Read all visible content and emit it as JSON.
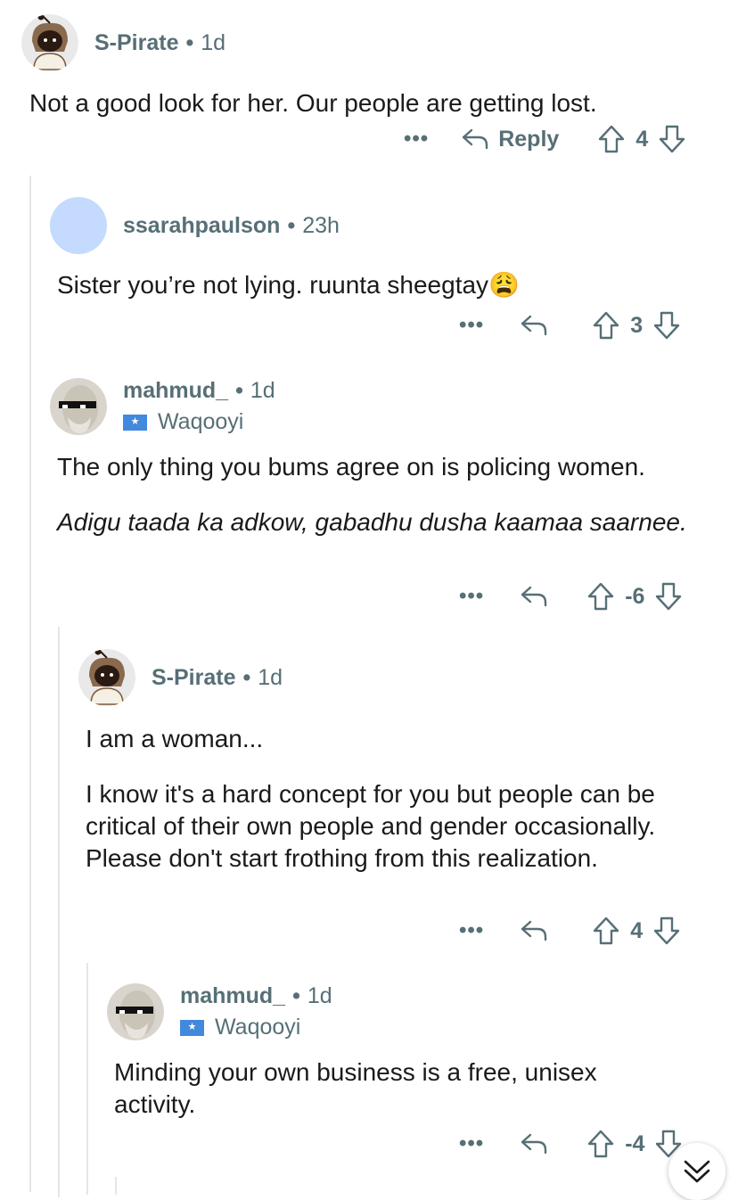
{
  "comments": [
    {
      "username": "S-Pirate",
      "time": "1d",
      "body": [
        "Not a good look for her. Our people are getting lost."
      ],
      "reply_label": "Reply",
      "votes": "4",
      "avatar": "pirate-snoo-avatar"
    },
    {
      "username": "ssarahpaulson",
      "time": "23h",
      "body": [
        "Sister you’re not lying. ruunta sheegtay"
      ],
      "emoji": "😩",
      "votes": "3",
      "avatar": "default-blue-avatar",
      "avatar_color": "#c4dafe"
    },
    {
      "username": "mahmud_",
      "time": "1d",
      "flair": "Waqooyi",
      "body": [
        "The only thing you bums agree on is policing women.",
        "Adigu taada ka adkow, gabadhu dusha kaamaa saarnee."
      ],
      "votes": "-6",
      "avatar": "statue-sunglasses-avatar"
    },
    {
      "username": "S-Pirate",
      "time": "1d",
      "body": [
        "I am a woman...",
        "I know it's a hard concept for you but people can be critical of their own people and gender occasionally. Please don't start frothing from this realization."
      ],
      "votes": "4",
      "avatar": "pirate-snoo-avatar"
    },
    {
      "username": "mahmud_",
      "time": "1d",
      "flair": "Waqooyi",
      "body": [
        "Minding your own business is a free, unisex activity."
      ],
      "votes": "-4",
      "avatar": "statue-sunglasses-avatar"
    }
  ],
  "colors": {
    "meta": "#576f76",
    "text": "#1a1a1b",
    "thread": "#e5e5e5",
    "flag": "#4189dd"
  }
}
